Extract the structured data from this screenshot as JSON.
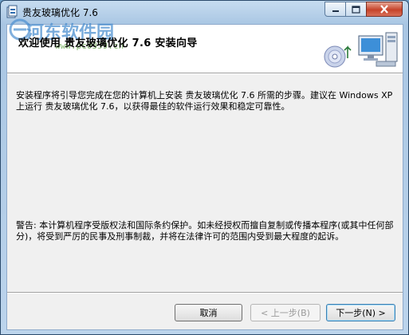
{
  "window": {
    "title": "贵友玻璃优化 7.6"
  },
  "banner": {
    "title": "欢迎使用 贵友玻璃优化 7.6 安装向导",
    "watermark_text": "河东软件园",
    "watermark_url": "www.pc0359.cn",
    "graphic": "install-computer-cd-icon"
  },
  "body": {
    "intro": "安装程序将引导您完成在您的计算机上安装 贵友玻璃优化 7.6 所需的步骤。建议在 Windows XP 上运行 贵友玻璃优化 7.6，以获得最佳的软件运行效果和稳定可靠性。",
    "warning": "警告: 本计算机程序受版权法和国际条约保护。如未经授权而擅自复制或传播本程序(或其中任何部分)，将受到严厉的民事及刑事制裁，并将在法律许可的范围内受到最大程度的起诉。"
  },
  "buttons": {
    "cancel": "取消",
    "back": "< 上一步(B)",
    "next": "下一步(N) >"
  },
  "window_controls": {
    "minimize_icon": "minimize-icon",
    "maximize_icon": "maximize-icon",
    "close_icon": "close-icon"
  }
}
